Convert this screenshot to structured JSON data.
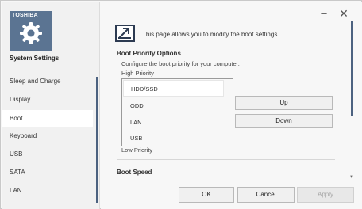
{
  "sidebar": {
    "brand": "TOSHIBA",
    "title": "System Settings",
    "items": [
      {
        "label": "Sleep and Charge"
      },
      {
        "label": "Display"
      },
      {
        "label": "Boot"
      },
      {
        "label": "Keyboard"
      },
      {
        "label": "USB"
      },
      {
        "label": "SATA"
      },
      {
        "label": "LAN"
      }
    ],
    "active_item": "Boot"
  },
  "window": {
    "minimize_icon": "minimize-icon",
    "close_icon": "close-icon"
  },
  "main": {
    "page_description": "This page allows you to modify the boot settings.",
    "boot_priority": {
      "title": "Boot Priority Options",
      "description": "Configure the boot priority for your computer.",
      "high_label": "High Priority",
      "low_label": "Low Priority",
      "items": [
        "HDD/SSD",
        "ODD",
        "LAN",
        "USB"
      ],
      "selected": "HDD/SSD",
      "up_label": "Up",
      "down_label": "Down"
    },
    "boot_speed": {
      "title": "Boot Speed"
    }
  },
  "footer": {
    "ok_label": "OK",
    "cancel_label": "Cancel",
    "apply_label": "Apply"
  },
  "colors": {
    "brand": "#5b7492",
    "accent": "#4c6280",
    "sidebar_bg": "#f1f1f1",
    "panel_bg": "#f7f7f7"
  }
}
